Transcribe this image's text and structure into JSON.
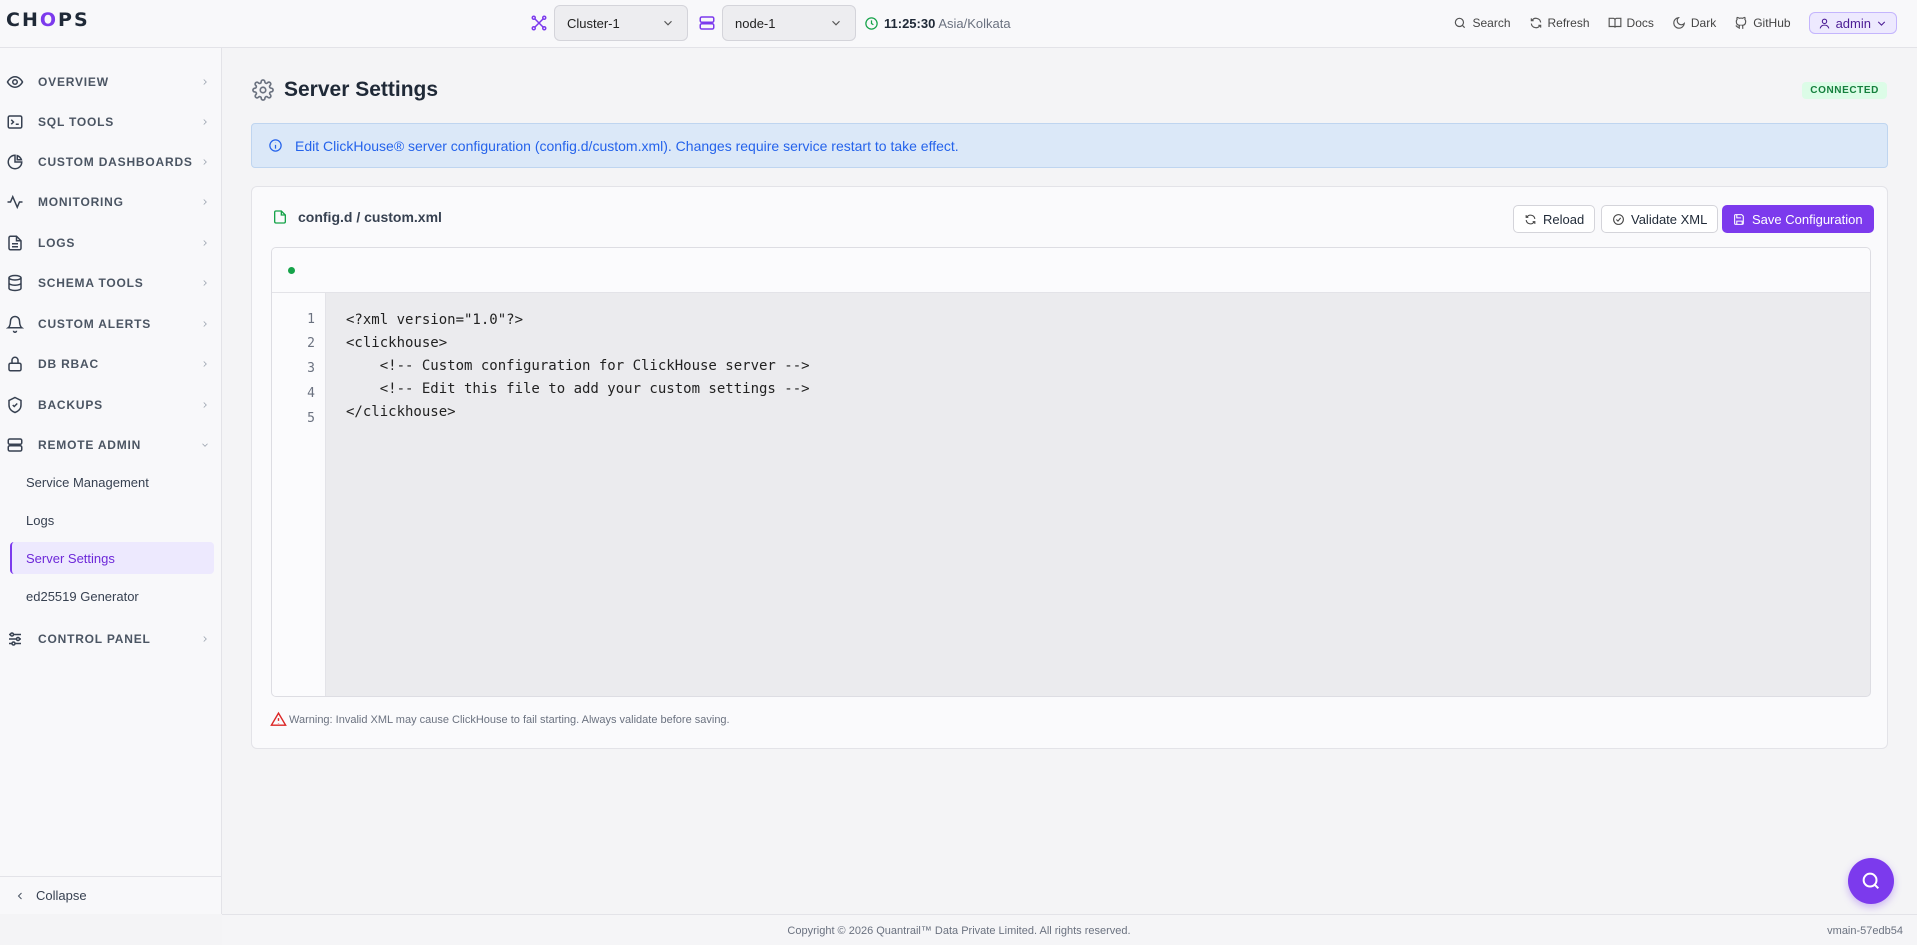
{
  "topbar": {
    "logo_pre": "CH",
    "logo_accent": "O",
    "logo_post": "PS",
    "cluster": "Cluster-1",
    "node": "node-1",
    "time": "11:25:30",
    "timezone": "Asia/Kolkata",
    "actions": {
      "search": "Search",
      "refresh": "Refresh",
      "docs": "Docs",
      "dark": "Dark",
      "github": "GitHub"
    },
    "user": "admin"
  },
  "sidebar": {
    "items": [
      {
        "label": "OVERVIEW"
      },
      {
        "label": "SQL TOOLS"
      },
      {
        "label": "CUSTOM DASHBOARDS"
      },
      {
        "label": "MONITORING"
      },
      {
        "label": "LOGS"
      },
      {
        "label": "SCHEMA TOOLS"
      },
      {
        "label": "CUSTOM ALERTS"
      },
      {
        "label": "DB RBAC"
      },
      {
        "label": "BACKUPS"
      },
      {
        "label": "REMOTE ADMIN"
      },
      {
        "label": "CONTROL PANEL"
      }
    ],
    "remote_admin_children": [
      {
        "label": "Service Management"
      },
      {
        "label": "Logs"
      },
      {
        "label": "Server Settings"
      },
      {
        "label": "ed25519 Generator"
      }
    ],
    "collapse_label": "Collapse"
  },
  "page": {
    "title": "Server Settings",
    "status": "CONNECTED",
    "info": "Edit ClickHouse® server configuration (config.d/custom.xml). Changes require service restart to take effect."
  },
  "editor": {
    "file_path": "config.d / custom.xml",
    "reload_label": "Reload",
    "validate_label": "Validate XML",
    "save_label": "Save Configuration",
    "lines": [
      {
        "n": "1",
        "text": "<?xml version=\"1.0\"?>"
      },
      {
        "n": "2",
        "text": "<clickhouse>"
      },
      {
        "n": "3",
        "text": "    <!-- Custom configuration for ClickHouse server -->"
      },
      {
        "n": "4",
        "text": "    <!-- Edit this file to add your custom settings -->"
      },
      {
        "n": "5",
        "text": "</clickhouse>"
      }
    ],
    "warning": "Warning: Invalid XML may cause ClickHouse to fail starting. Always validate before saving."
  },
  "footer": {
    "copyright": "Copyright © 2026 Quantrail™ Data Private Limited. All rights reserved.",
    "version": "vmain-57edb54"
  },
  "colors": {
    "accent": "#7c3aed",
    "connected": "#15803d",
    "info": "#2563eb",
    "warning": "#dc2626"
  }
}
